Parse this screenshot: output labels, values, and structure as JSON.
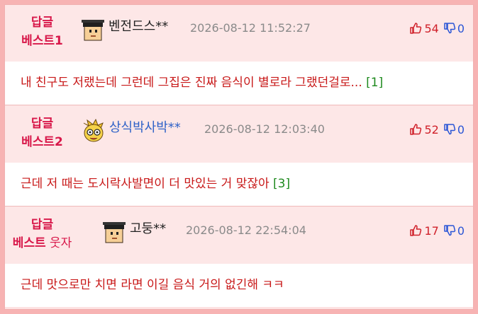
{
  "replies": [
    {
      "badge_line1": "답글",
      "badge_line2": "베스트1",
      "badge_extra": "",
      "nickname": "벤전드스**",
      "nickname_color": "#222222",
      "avatar": "graduate-avatar-icon",
      "time": "2026-08-12 11:52:27",
      "likes": "54",
      "dislikes": "0",
      "content": "내 친구도 저랬는데 그런데 그집은 진짜 음식이 별로라 그랬던걸로...",
      "reply_count": "[1]"
    },
    {
      "badge_line1": "답글",
      "badge_line2": "베스트2",
      "badge_extra": "",
      "nickname": "상식박사박**",
      "nickname_color": "#2f62c8",
      "avatar": "cartoon-character-avatar-icon",
      "time": "2026-08-12 12:03:40",
      "likes": "52",
      "dislikes": "0",
      "content": "근데 저 때는 도시락사발면이 더 맛있는 거 맞잖아",
      "reply_count": "[3]"
    },
    {
      "badge_line1": "답글",
      "badge_line2": "베스트",
      "badge_extra": " 웃자",
      "nickname": "고둥**",
      "nickname_color": "#222222",
      "avatar": "graduate-avatar-icon",
      "time": "2026-08-12 22:54:04",
      "likes": "17",
      "dislikes": "0",
      "content": "근데 맛으로만 치면 라면 이길 음식 거의 없긴해 ㅋㅋ",
      "reply_count": ""
    }
  ],
  "colors": {
    "badge": "#d8184a",
    "content": "#c81818",
    "like": "#d0202a",
    "dislike": "#2a55d6",
    "reply_count": "#1f8a1f",
    "outer_background": "#f7b3b3",
    "header_background": "#fde7e7"
  }
}
